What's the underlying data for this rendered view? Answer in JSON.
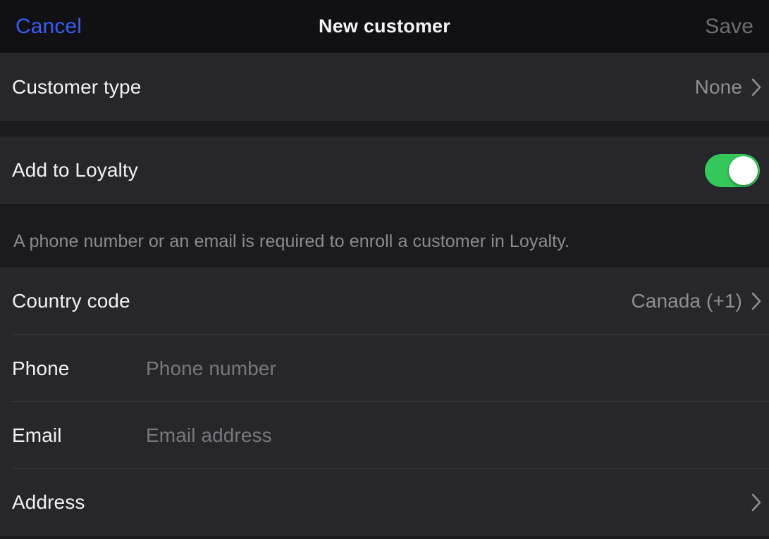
{
  "navbar": {
    "cancel_label": "Cancel",
    "title": "New customer",
    "save_label": "Save",
    "cancel_color": "#3b5bf2",
    "save_color": "#6d6d73"
  },
  "sections": {
    "customer_type": {
      "label": "Customer type",
      "value": "None",
      "disclosure_icon": "chevron-right-icon"
    },
    "loyalty": {
      "label": "Add to Loyalty",
      "toggle_state": "on",
      "toggle_on_color": "#34c759",
      "toggle_knob_color": "#ffffff",
      "footer_note": "A phone number or an email is required to enroll a customer in Loyalty."
    },
    "country_code": {
      "label": "Country code",
      "value": "Canada (+1)",
      "disclosure_icon": "chevron-right-icon"
    },
    "phone": {
      "label": "Phone",
      "value": "",
      "placeholder": "Phone number"
    },
    "email": {
      "label": "Email",
      "value": "",
      "placeholder": "Email address"
    },
    "address": {
      "label": "Address",
      "value": "",
      "disclosure_icon": "chevron-right-icon"
    }
  },
  "theme": {
    "window_bg": "#1b1b1f",
    "navbar_bg": "#111114",
    "row_bg": "#26262b",
    "separator": "#34343a",
    "primary_text": "#f2f2f4",
    "secondary_text": "#8e8e93"
  }
}
